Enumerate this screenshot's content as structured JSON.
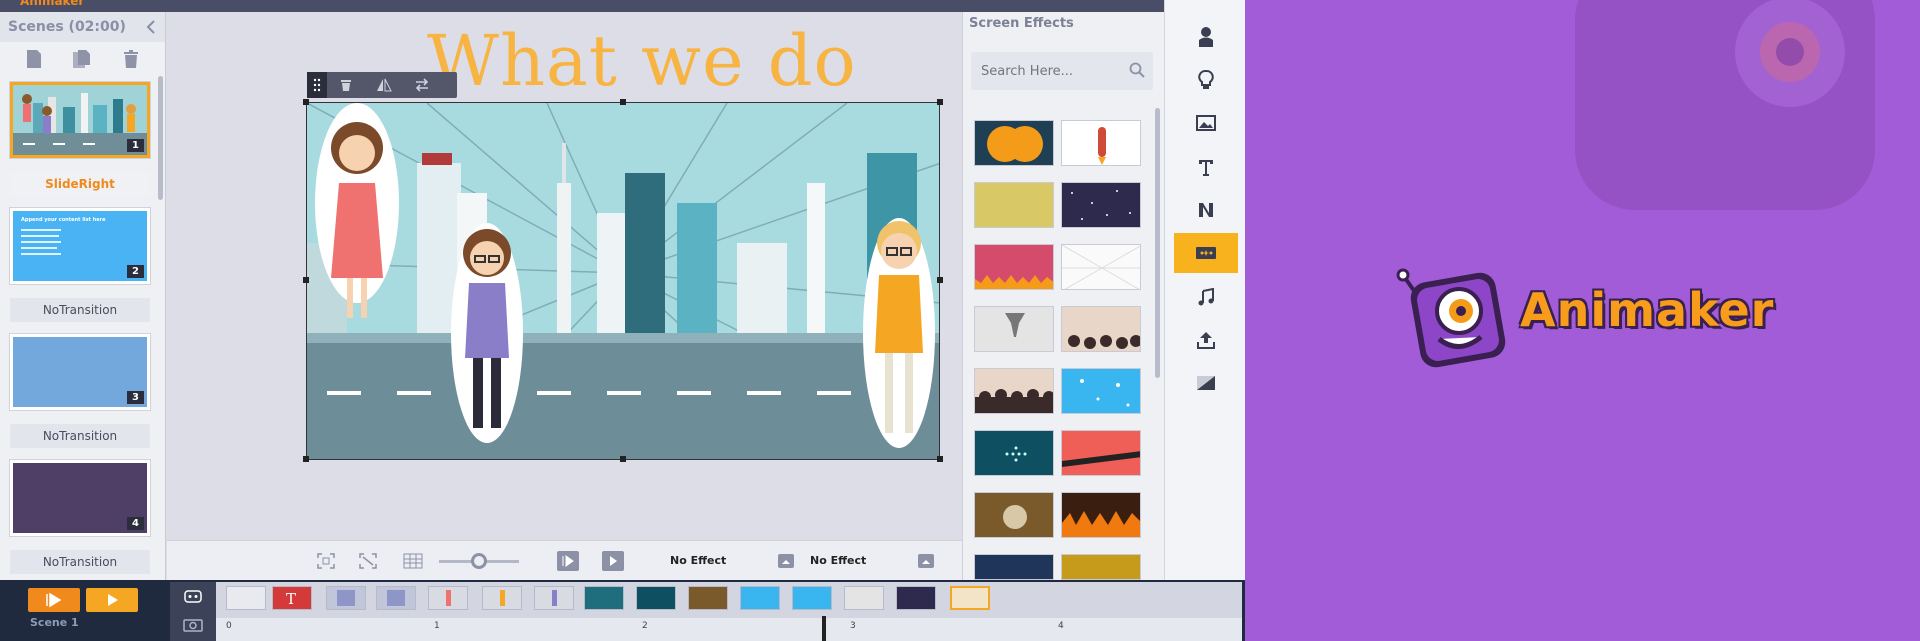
{
  "app": {
    "brand": "Animaker"
  },
  "scenes_panel": {
    "title": "Scenes (02:00)",
    "scenes": [
      {
        "number": "1",
        "transition": "SlideRight"
      },
      {
        "number": "2",
        "transition": "NoTransition",
        "thumb_text": "Append your content list here"
      },
      {
        "number": "3",
        "transition": "NoTransition"
      },
      {
        "number": "4",
        "transition": "NoTransition"
      }
    ]
  },
  "stage": {
    "title": "What we do",
    "bottom_bar": {
      "enter_effect": "No Effect",
      "exit_effect": "No Effect"
    }
  },
  "effects_panel": {
    "title": "Screen Effects",
    "search_placeholder": "Search Here..."
  },
  "timeline": {
    "scene_label": "Scene 1",
    "ruler_ticks": [
      "0",
      "1",
      "2",
      "3",
      "4"
    ]
  },
  "promo": {
    "logo_text": "Animaker"
  },
  "colors": {
    "accent": "#f7b21d",
    "brand_orange": "#f08a1c",
    "background_purple": "#a35cd8"
  }
}
